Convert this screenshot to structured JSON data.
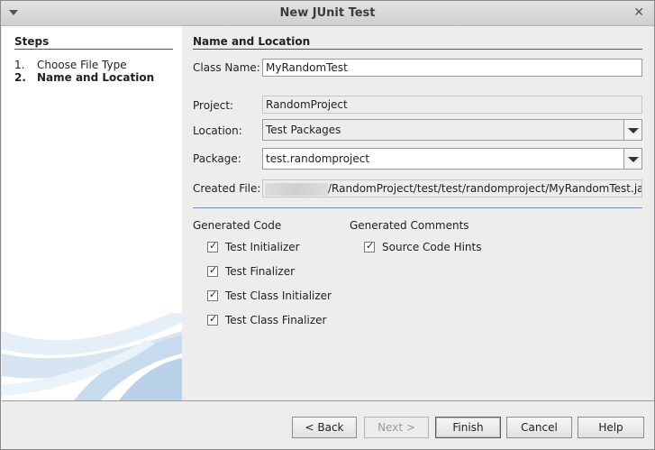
{
  "window": {
    "title": "New JUnit Test"
  },
  "steps": {
    "title": "Steps",
    "items": [
      {
        "number": "1.",
        "label": "Choose File Type",
        "current": false
      },
      {
        "number": "2.",
        "label": "Name and Location",
        "current": true
      }
    ]
  },
  "form": {
    "section_title": "Name and Location",
    "class_name": {
      "label": "Class Name:",
      "value": "MyRandomTest"
    },
    "project": {
      "label": "Project:",
      "value": "RandomProject"
    },
    "location": {
      "label": "Location:",
      "value": "Test Packages"
    },
    "package": {
      "label": "Package:",
      "value": "test.randomproject"
    },
    "created_file": {
      "label": "Created File:",
      "value": "/RandomProject/test/test/randomproject/MyRandomTest.java"
    }
  },
  "generated_code": {
    "title": "Generated Code",
    "options": [
      {
        "label": "Test Initializer",
        "checked": true
      },
      {
        "label": "Test Finalizer",
        "checked": true
      },
      {
        "label": "Test Class Initializer",
        "checked": true
      },
      {
        "label": "Test Class Finalizer",
        "checked": true
      }
    ]
  },
  "generated_comments": {
    "title": "Generated Comments",
    "options": [
      {
        "label": "Source Code Hints",
        "checked": true
      }
    ]
  },
  "buttons": {
    "back": "< Back",
    "next": "Next >",
    "finish": "Finish",
    "cancel": "Cancel",
    "help": "Help"
  }
}
